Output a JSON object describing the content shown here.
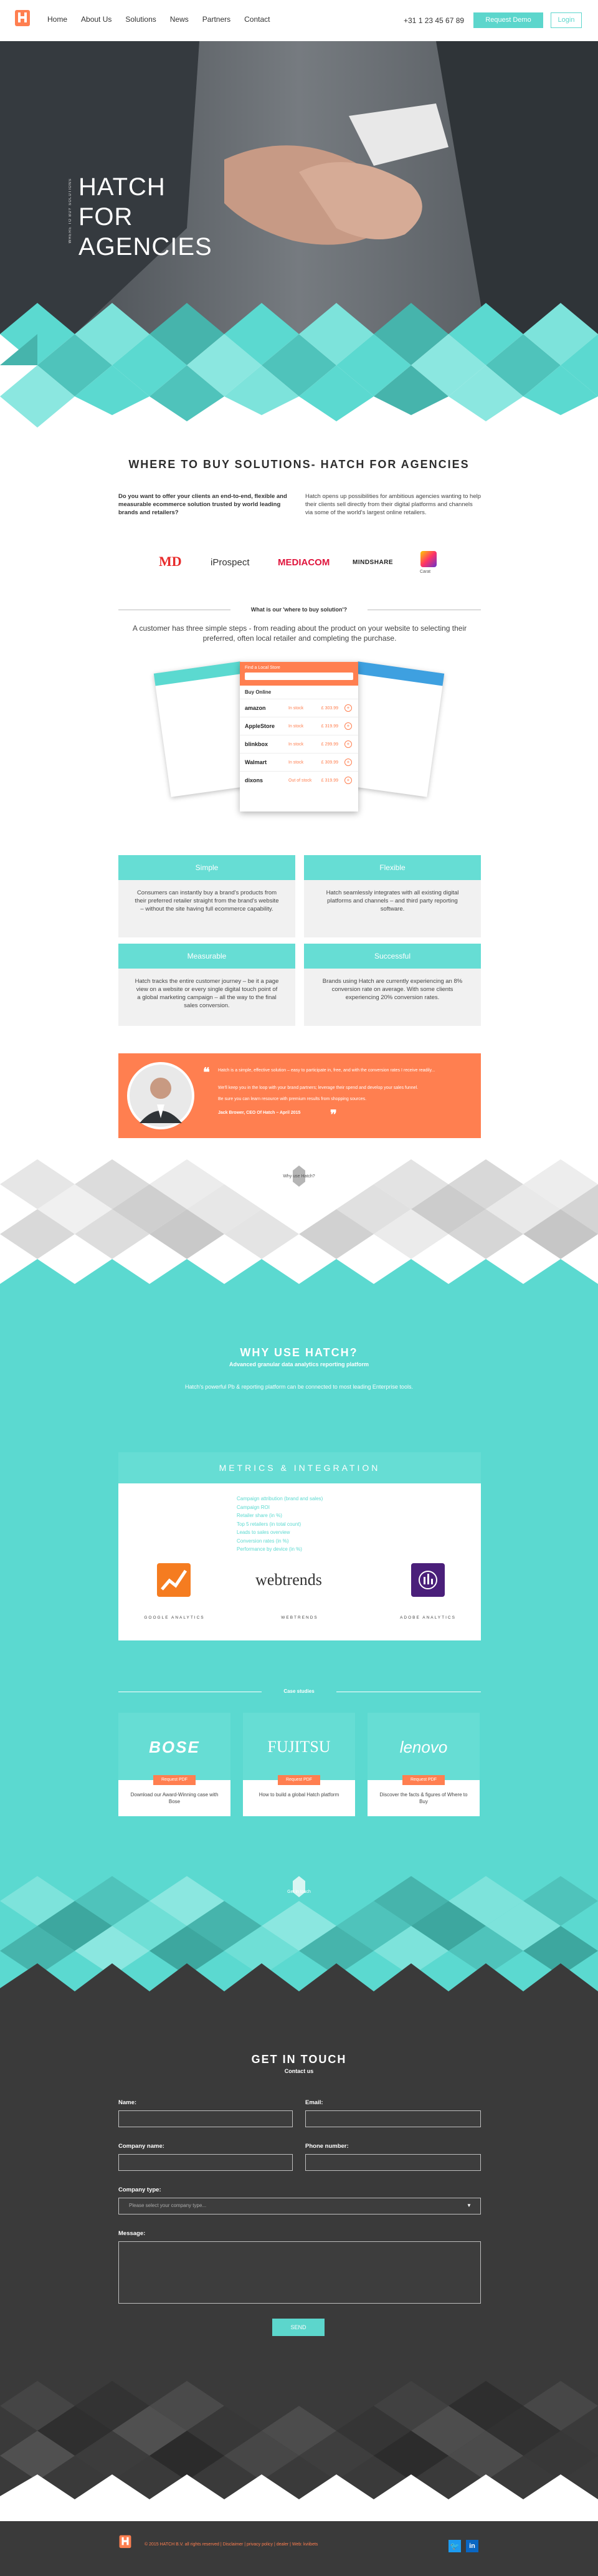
{
  "nav": {
    "links": [
      "Home",
      "About Us",
      "Solutions",
      "News",
      "Partners",
      "Contact"
    ],
    "phone": "+31 1 23 45 67 89",
    "request_demo": "Request Demo",
    "login": "Login",
    "logo_text": "HATCH"
  },
  "hero": {
    "title_lines": [
      "HATCH",
      "FOR",
      "AGENCIES"
    ],
    "side_text": "WHERE TO BUY SOLUTIONS"
  },
  "where_to_buy": {
    "heading": "WHERE TO BUY SOLUTIONS- HATCH FOR AGENCIES",
    "left_para": "Do you want to offer your clients an end-to-end, flexible and measurable ecommerce solution trusted by world leading brands and retailers?",
    "right_para": "Hatch opens up possibilities for ambitious agencies wanting to help their clients sell directly from their digital platforms and channels via some of the world's largest online retailers.",
    "partners": [
      "MD",
      "iProspect",
      "MEDIACOM",
      "MINDSHARE",
      "Carat"
    ]
  },
  "what_is": {
    "label": "What is our 'where to buy solution'?",
    "description": "A customer has three simple steps - from reading about the product on your website to selecting their preferred, often local retailer and completing the purchase."
  },
  "mockup": {
    "header": "Find a Local Store",
    "section_label": "Buy Online",
    "retailers": [
      {
        "name": "amazon",
        "stock": "In stock",
        "price": "£ 303.99"
      },
      {
        "name": "AppleStore",
        "stock": "In stock",
        "price": "£ 319.99"
      },
      {
        "name": "blinkbox",
        "stock": "In stock",
        "price": "£ 299.99"
      },
      {
        "name": "Walmart",
        "stock": "In stock",
        "price": "£ 309.99"
      },
      {
        "name": "dixons",
        "stock": "Out of stock",
        "price": "£ 319.99"
      }
    ]
  },
  "features": [
    {
      "title": "Simple",
      "text": "Consumers can instantly buy a brand's products from their preferred retailer straight from the brand's website – without the site having full ecommerce capability."
    },
    {
      "title": "Flexible",
      "text": "Hatch seamlessly integrates with all existing digital platforms and channels – and third party reporting software."
    },
    {
      "title": "Measurable",
      "text": "Hatch tracks the entire customer journey – be it a page view on a website or every single digital touch point of a global marketing campaign – all the way to the final sales conversion."
    },
    {
      "title": "Successful",
      "text": "Brands using Hatch are currently experiencing an 8% conversion rate on average. With some clients experiencing 20% conversion rates."
    }
  ],
  "quote": {
    "line1": "Hatch is a simple, effective solution – easy to participate in, free, and with the conversion rates I receive readily...",
    "line2": "We'll keep you in the loop with your brand partners; leverage their spend and develop your sales funnel.",
    "line3": "Be sure you can learn resource with premium results from shopping sources.",
    "author": "Jack Brower, CEO Of Hatch – April 2015"
  },
  "why_use_label": "Why use Hatch?",
  "why": {
    "heading": "WHY USE HATCH?",
    "subheading": "Advanced granular data analytics reporting platform",
    "description": "Hatch's powerful Pb & reporting platform can be connected to most leading Enterprise tools."
  },
  "metrics": {
    "heading": "METRICS & INTEGRATION",
    "items": [
      "Campaign attribution (brand and sales)",
      "Campaign ROI",
      "Retailer share (in %)",
      "Top 5 retailers (in total count)",
      "Leads to sales overview",
      "Conversion rates (in %)",
      "Performance by device (in %)"
    ],
    "logos": [
      {
        "name": "webtrends"
      }
    ],
    "captions": [
      "GOOGLE ANALYTICS",
      "WEBTRENDS",
      "ADOBE ANALYTICS"
    ]
  },
  "case_studies": {
    "label": "Case studies",
    "items": [
      {
        "brand": "BOSE",
        "button": "Request PDF",
        "text": "Download our Award-Winning case with Bose"
      },
      {
        "brand": "FUJITSU",
        "button": "Request PDF",
        "text": "How to build a global Hatch platform"
      },
      {
        "brand": "lenovo",
        "button": "Request PDF",
        "text": "Discover the facts & figures of Where to Buy"
      }
    ]
  },
  "get_in_touch_label": "Get in touch",
  "contact": {
    "heading": "GET IN TOUCH",
    "subheading": "Contact us",
    "name_label": "Name:",
    "email_label": "Email:",
    "company_label": "Company name:",
    "phone_label": "Phone number:",
    "type_label": "Company type:",
    "type_placeholder": "Please select your company type...",
    "message_label": "Message:",
    "send": "SEND"
  },
  "footer": {
    "text": "© 2015 HATCH B.V. all rights reserved | Disclaimer | privacy policy | dealer | Web: kviibets"
  },
  "colors": {
    "teal": "#5bd9d0",
    "orange": "#ff7f50",
    "dark": "#3a3a3a"
  }
}
